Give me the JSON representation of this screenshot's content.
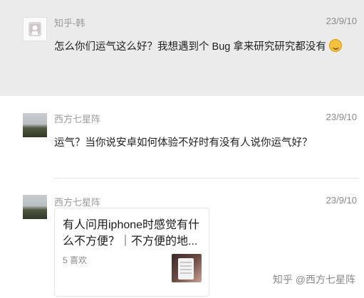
{
  "messages": [
    {
      "sender": "知乎-韩",
      "time": "23/9/10",
      "text": "怎么你们运气这么好？我想遇到个 Bug 拿来研究研究都没有",
      "emoji": "grinning-emoji"
    },
    {
      "sender": "西方七星阵",
      "time": "23/9/10",
      "text": "运气？当你说安卓如何体验不好时有没有人说你运气好？"
    },
    {
      "sender": "西方七星阵",
      "time": "23/9/10",
      "card": {
        "title": "有人问用iphone时感觉有什么不方便？｜不方便的地...",
        "likes": "5 喜欢"
      }
    }
  ],
  "watermark": "知乎 @西方七星阵",
  "colors": {
    "highlight_bg": "#ebebeb",
    "meta_text": "#9a9a9a"
  }
}
